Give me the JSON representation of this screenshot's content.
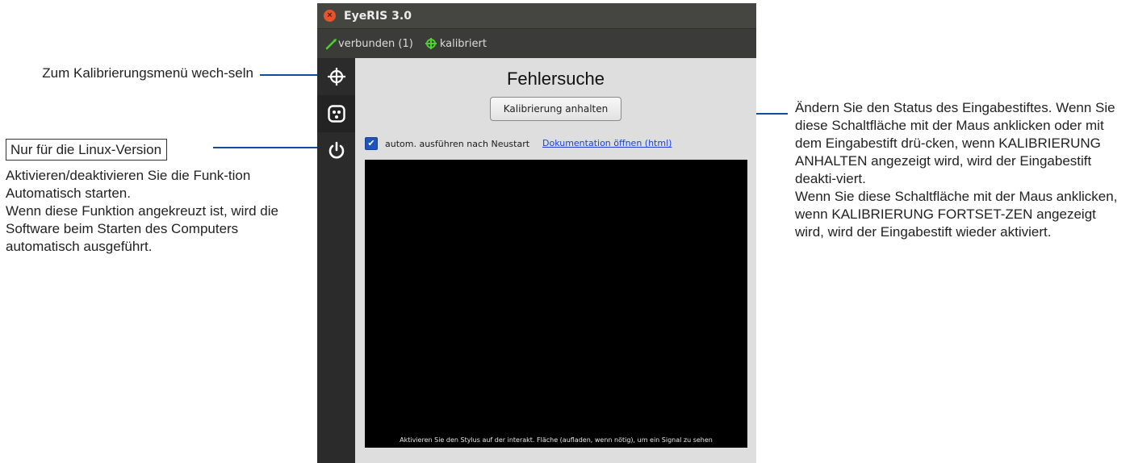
{
  "window": {
    "title": "EyeRIS 3.0",
    "close_icon": "close-icon",
    "status": [
      {
        "icon": "connected-icon",
        "label": "verbunden (1)"
      },
      {
        "icon": "calibrated-crosshair-icon",
        "label": "kalibriert"
      }
    ],
    "sidebar": [
      "crosshair-icon",
      "dice-icon",
      "power-icon"
    ]
  },
  "main": {
    "heading": "Fehlersuche",
    "stop_button": "Kalibrierung anhalten",
    "autostart_checkbox": {
      "checked": true,
      "label": "autom. ausführen nach Neustart"
    },
    "doc_link": "Dokumentation öffnen (html)",
    "canvas_hint": "Aktivieren Sie den Stylus auf der interakt. Fläche (aufladen, wenn nötig), um ein Signal zu sehen"
  },
  "callouts": {
    "left_top": "Zum Kalibrierungsmenü wech-seln",
    "left_box": "Nur für die Linux-Version",
    "left_body": "Aktivieren/deaktivieren Sie die Funk-tion Automatisch starten.\nWenn diese Funktion angekreuzt ist, wird die Software beim Starten des Computers automatisch ausgeführt.",
    "right_body": "Ändern Sie den Status des Eingabestiftes. Wenn Sie diese Schaltfläche mit der Maus anklicken oder mit dem Eingabestift drü-cken, wenn KALIBRIERUNG ANHALTEN angezeigt wird, wird der Eingabestift deakti-viert.\nWenn Sie diese Schaltfläche mit der Maus anklicken, wenn KALIBRIERUNG FORTSET-ZEN angezeigt wird, wird der Eingabestift wieder aktiviert."
  },
  "colors": {
    "accent_line": "#0d4f9e",
    "status_green": "#4cd12f",
    "checkbox_blue": "#1f55b8"
  }
}
